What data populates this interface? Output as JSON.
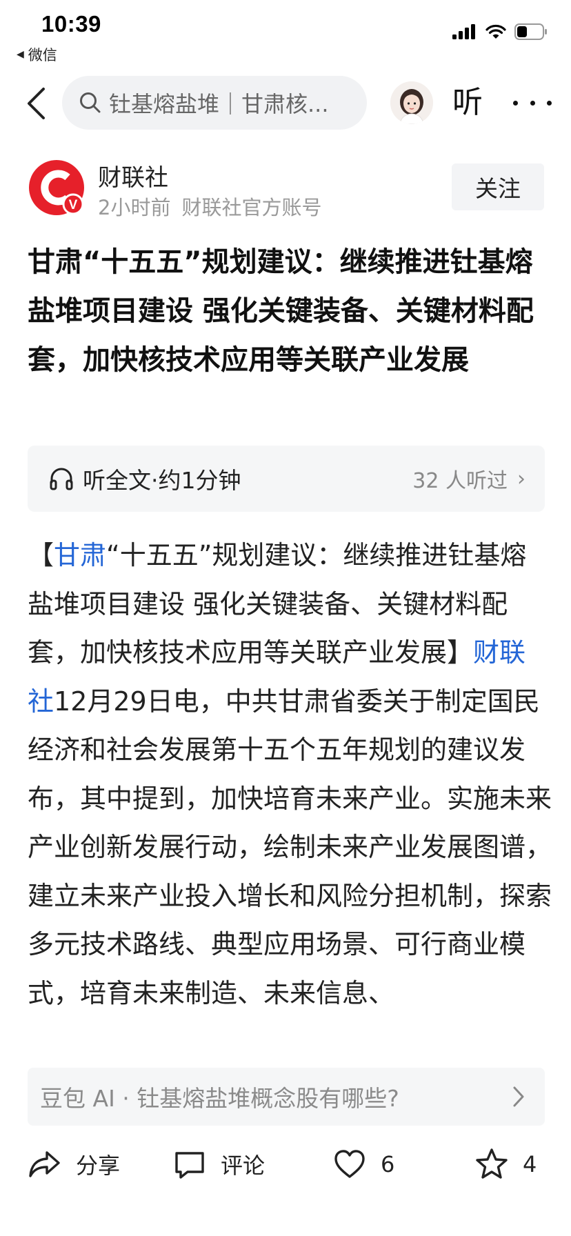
{
  "status_bar": {
    "time": "10:39",
    "back_app": "微信",
    "battery_percent": 40
  },
  "nav": {
    "search_text": "钍基熔盐堆｜甘肃核...",
    "listen_label": "听"
  },
  "author": {
    "name": "财联社",
    "time_ago": "2小时前",
    "account_type": "财联社官方账号",
    "follow_label": "关注",
    "verified_badge": "V"
  },
  "article": {
    "headline": "甘肃“十五五”规划建议：继续推进钍基熔盐堆项目建设 强化关键装备、关键材料配套，加快核技术应用等关联产业发展",
    "listen": {
      "label": "听全文·约1分钟",
      "count": "32 人听过"
    },
    "body": {
      "bracket_open": "【",
      "link1": "甘肃",
      "part1": "“十五五”规划建议：继续推进钍基熔盐堆项目建设 强化关键装备、关键材料配套，加快核技术应用等关联产业发展",
      "bracket_close": "】",
      "link2": "财联社",
      "part2": "12月29日电，中共甘肃省委关于制定国民经济和社会发展第十五个五年规划的建议发布，其中提到，加快培育未来产业。实施未来产业创新发展行动，绘制未来产业发展图谱，建立未来产业投入增长和风险分担机制，探索多元技术路线、典型应用场景、可行商业模式，培育未来制造、未来信息、"
    }
  },
  "ai_prompt": {
    "text": "豆包 AI · 钍基熔盐堆概念股有哪些?"
  },
  "actions": {
    "share": "分享",
    "comment": "评论",
    "like_count": "6",
    "favorite_count": "4"
  },
  "colors": {
    "link": "#2466d6",
    "brand_red": "#e6202a",
    "panel_bg": "#f5f6f7"
  }
}
